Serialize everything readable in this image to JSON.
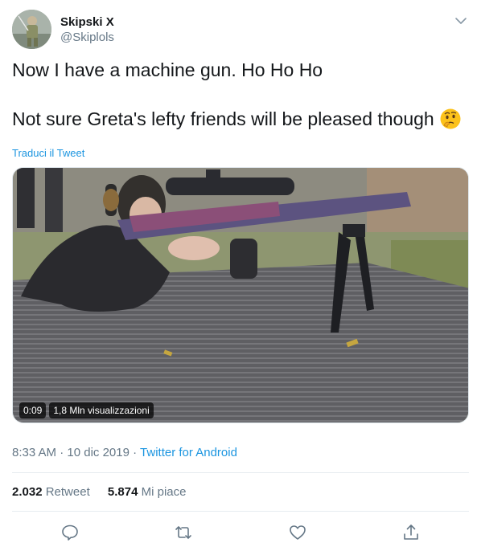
{
  "user": {
    "display_name": "Skipski X",
    "handle": "@Skiplols"
  },
  "tweet": {
    "line1": "Now I have a machine gun. Ho Ho Ho",
    "line2": "Not sure Greta's lefty friends will be pleased though",
    "emoji": "thinking-face-emoji",
    "translate_label": "Traduci il Tweet"
  },
  "video": {
    "duration": "0:09",
    "views": "1,8 Mln visualizzazioni"
  },
  "meta": {
    "time": "8:33 AM",
    "date": "10 dic 2019",
    "separator": "·",
    "source": "Twitter for Android"
  },
  "stats": {
    "retweets_count": "2.032",
    "retweets_label": "Retweet",
    "likes_count": "5.874",
    "likes_label": "Mi piace"
  },
  "icons": {
    "more": "chevron-down-icon",
    "reply": "reply-icon",
    "retweet": "retweet-icon",
    "like": "heart-icon",
    "share": "share-icon"
  },
  "colors": {
    "link": "#1b95e0",
    "secondary_text": "#657786",
    "primary_text": "#14171a",
    "icon": "#657786"
  }
}
